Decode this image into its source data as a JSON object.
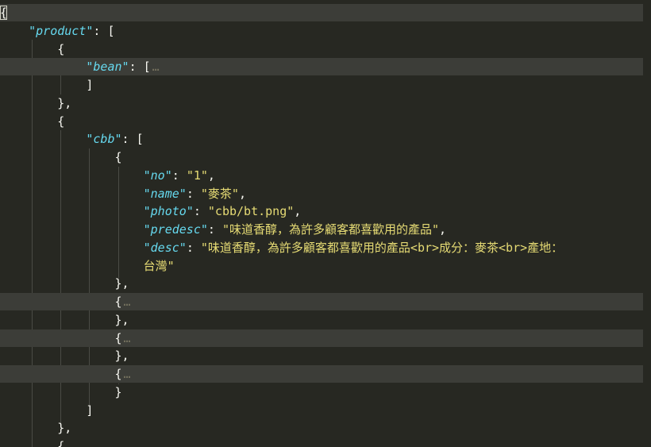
{
  "editor": {
    "lines": [
      {
        "tokens": [
          {
            "t": "punc",
            "v": "{"
          }
        ]
      },
      {
        "tokens": [
          {
            "t": "punc",
            "v": "    "
          },
          {
            "t": "key",
            "v": "\"product\""
          },
          {
            "t": "punc",
            "v": ": ["
          }
        ]
      },
      {
        "tokens": [
          {
            "t": "punc",
            "v": "        {"
          }
        ]
      },
      {
        "tokens": [
          {
            "t": "punc",
            "v": "            "
          },
          {
            "t": "key",
            "v": "\"bean\""
          },
          {
            "t": "punc",
            "v": ": ["
          },
          {
            "t": "fold",
            "v": "…"
          }
        ]
      },
      {
        "tokens": [
          {
            "t": "punc",
            "v": "            ]"
          }
        ]
      },
      {
        "tokens": [
          {
            "t": "punc",
            "v": "        },"
          }
        ]
      },
      {
        "tokens": [
          {
            "t": "punc",
            "v": "        {"
          }
        ]
      },
      {
        "tokens": [
          {
            "t": "punc",
            "v": "            "
          },
          {
            "t": "key",
            "v": "\"cbb\""
          },
          {
            "t": "punc",
            "v": ": ["
          }
        ]
      },
      {
        "tokens": [
          {
            "t": "punc",
            "v": "                {"
          }
        ]
      },
      {
        "tokens": [
          {
            "t": "punc",
            "v": "                    "
          },
          {
            "t": "key",
            "v": "\"no\""
          },
          {
            "t": "punc",
            "v": ": "
          },
          {
            "t": "str",
            "v": "\"1\""
          },
          {
            "t": "punc",
            "v": ","
          }
        ]
      },
      {
        "tokens": [
          {
            "t": "punc",
            "v": "                    "
          },
          {
            "t": "key",
            "v": "\"name\""
          },
          {
            "t": "punc",
            "v": ": "
          },
          {
            "t": "str",
            "v": "\"麥茶\""
          },
          {
            "t": "punc",
            "v": ","
          }
        ]
      },
      {
        "tokens": [
          {
            "t": "punc",
            "v": "                    "
          },
          {
            "t": "key",
            "v": "\"photo\""
          },
          {
            "t": "punc",
            "v": ": "
          },
          {
            "t": "str",
            "v": "\"cbb/bt.png\""
          },
          {
            "t": "punc",
            "v": ","
          }
        ]
      },
      {
        "tokens": [
          {
            "t": "punc",
            "v": "                    "
          },
          {
            "t": "key",
            "v": "\"predesc\""
          },
          {
            "t": "punc",
            "v": ": "
          },
          {
            "t": "str",
            "v": "\"味道香醇，為許多顧客都喜歡用的產品\""
          },
          {
            "t": "punc",
            "v": ","
          }
        ]
      },
      {
        "tokens": [
          {
            "t": "punc",
            "v": "                    "
          },
          {
            "t": "key",
            "v": "\"desc\""
          },
          {
            "t": "punc",
            "v": ": "
          },
          {
            "t": "str",
            "v": "\"味道香醇，為許多顧客都喜歡用的產品<br>成分：麥茶<br>產地："
          }
        ]
      },
      {
        "tokens": [
          {
            "t": "punc",
            "v": "                    "
          },
          {
            "t": "str",
            "v": "台灣\""
          }
        ]
      },
      {
        "tokens": [
          {
            "t": "punc",
            "v": "                },"
          }
        ]
      },
      {
        "tokens": [
          {
            "t": "punc",
            "v": "                {"
          },
          {
            "t": "fold",
            "v": "…"
          }
        ]
      },
      {
        "tokens": [
          {
            "t": "punc",
            "v": "                },"
          }
        ]
      },
      {
        "tokens": [
          {
            "t": "punc",
            "v": "                {"
          },
          {
            "t": "fold",
            "v": "…"
          }
        ]
      },
      {
        "tokens": [
          {
            "t": "punc",
            "v": "                },"
          }
        ]
      },
      {
        "tokens": [
          {
            "t": "punc",
            "v": "                {"
          },
          {
            "t": "fold",
            "v": "…"
          }
        ]
      },
      {
        "tokens": [
          {
            "t": "punc",
            "v": "                }"
          }
        ]
      },
      {
        "tokens": [
          {
            "t": "punc",
            "v": "            ]"
          }
        ]
      },
      {
        "tokens": [
          {
            "t": "punc",
            "v": "        },"
          }
        ]
      },
      {
        "tokens": [
          {
            "t": "punc",
            "v": "        {"
          }
        ]
      }
    ]
  },
  "colors": {
    "background": "#272822",
    "key": "#66d9ef",
    "string": "#e6db74",
    "punctuation": "#f8f8f2",
    "fold_marker": "#75715e",
    "highlight_line": "#3c3d38"
  }
}
